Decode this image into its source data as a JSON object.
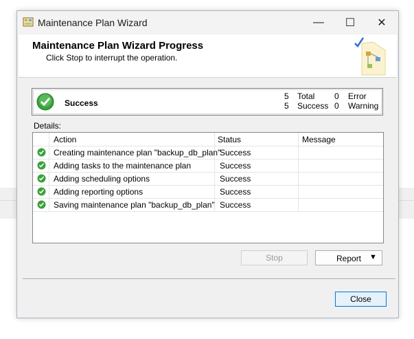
{
  "window": {
    "title": "Maintenance Plan Wizard",
    "controls": {
      "minimize": "—",
      "maximize": "☐",
      "close": "✕"
    }
  },
  "header": {
    "title": "Maintenance Plan Wizard Progress",
    "subtitle": "Click Stop to interrupt the operation."
  },
  "summary": {
    "status": "Success",
    "total_count": "5",
    "total_label": "Total",
    "success_count": "5",
    "success_label": "Success",
    "error_count": "0",
    "error_label": "Error",
    "warning_count": "0",
    "warning_label": "Warning"
  },
  "details": {
    "label": "Details:",
    "columns": [
      "Action",
      "Status",
      "Message"
    ],
    "rows": [
      {
        "action": "Creating maintenance plan \"backup_db_plan\"",
        "status": "Success",
        "message": ""
      },
      {
        "action": "Adding tasks to the maintenance plan",
        "status": "Success",
        "message": ""
      },
      {
        "action": "Adding scheduling options",
        "status": "Success",
        "message": ""
      },
      {
        "action": "Adding reporting options",
        "status": "Success",
        "message": ""
      },
      {
        "action": "Saving maintenance plan \"backup_db_plan\"",
        "status": "Success",
        "message": ""
      }
    ]
  },
  "buttons": {
    "stop": "Stop",
    "report": "Report",
    "report_arrow": "▼",
    "close": "Close"
  },
  "colors": {
    "success_green": "#3aa23a",
    "accent_blue": "#0078d7"
  }
}
